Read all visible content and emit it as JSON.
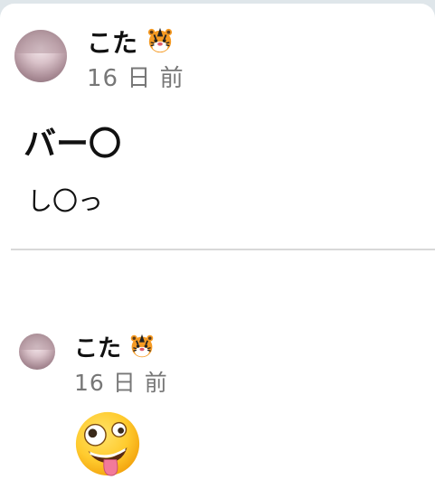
{
  "posts": [
    {
      "username": "こた",
      "username_emoji": "tiger-face",
      "time": "16 日 前",
      "title": "バー〇",
      "body": "し〇っ"
    },
    {
      "username": "こた",
      "username_emoji": "tiger-face",
      "time": "16 日 前",
      "reaction_emoji": "zany-face"
    }
  ]
}
